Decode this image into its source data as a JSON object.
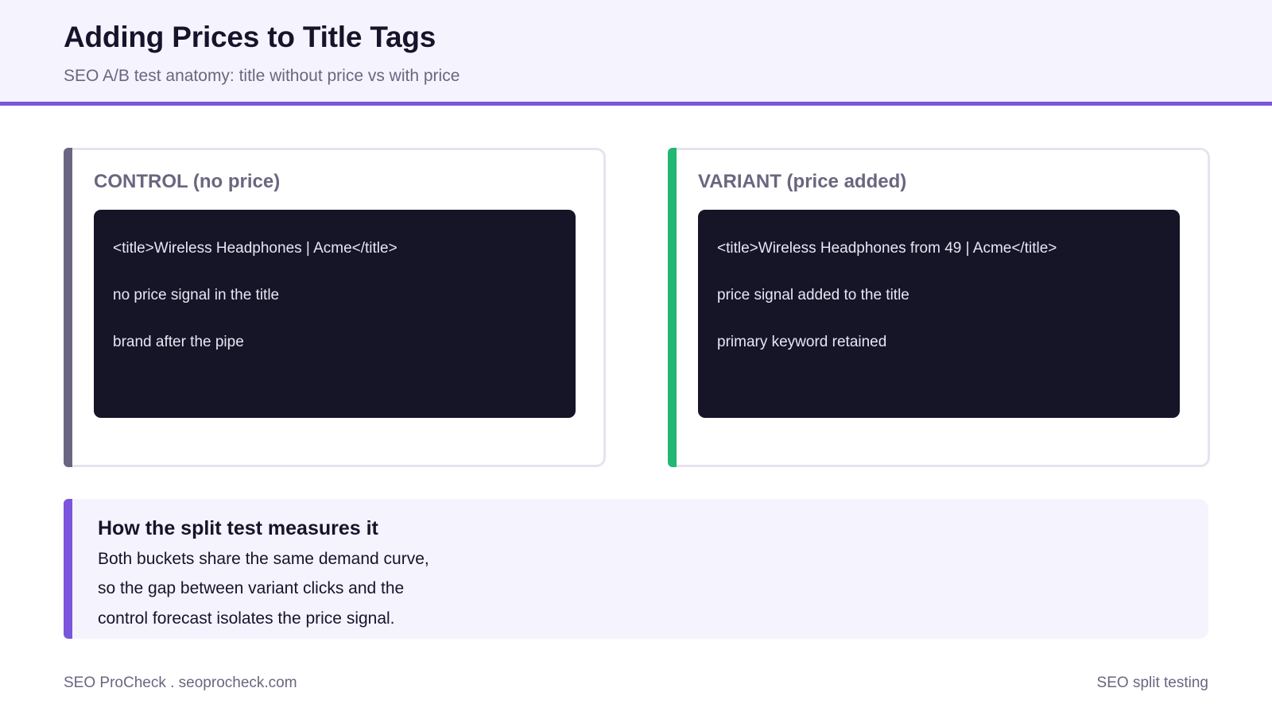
{
  "header": {
    "title": "Adding Prices to Title Tags",
    "subtitle": "SEO A/B test anatomy: title without price vs with price"
  },
  "control": {
    "heading": "CONTROL (no price)",
    "lines": [
      "<title>Wireless Headphones | Acme</title>",
      "no price signal in the title",
      "brand after the pipe"
    ]
  },
  "variant": {
    "heading": "VARIANT (price added)",
    "lines": [
      "<title>Wireless Headphones from 49 | Acme</title>",
      "price signal added to the title",
      "primary keyword retained"
    ]
  },
  "note": {
    "title": "How the split test measures it",
    "lines": [
      "Both buckets share the same demand curve,",
      "so the gap between variant clicks and the",
      "control forecast isolates the price signal."
    ]
  },
  "footer": {
    "left": "SEO ProCheck . seoprocheck.com",
    "right": "SEO split testing"
  },
  "colors": {
    "accent_purple": "#7b55dc",
    "control_accent": "#6b6584",
    "variant_accent": "#22b772",
    "code_background": "#161427",
    "header_background": "#f5f3fe"
  }
}
